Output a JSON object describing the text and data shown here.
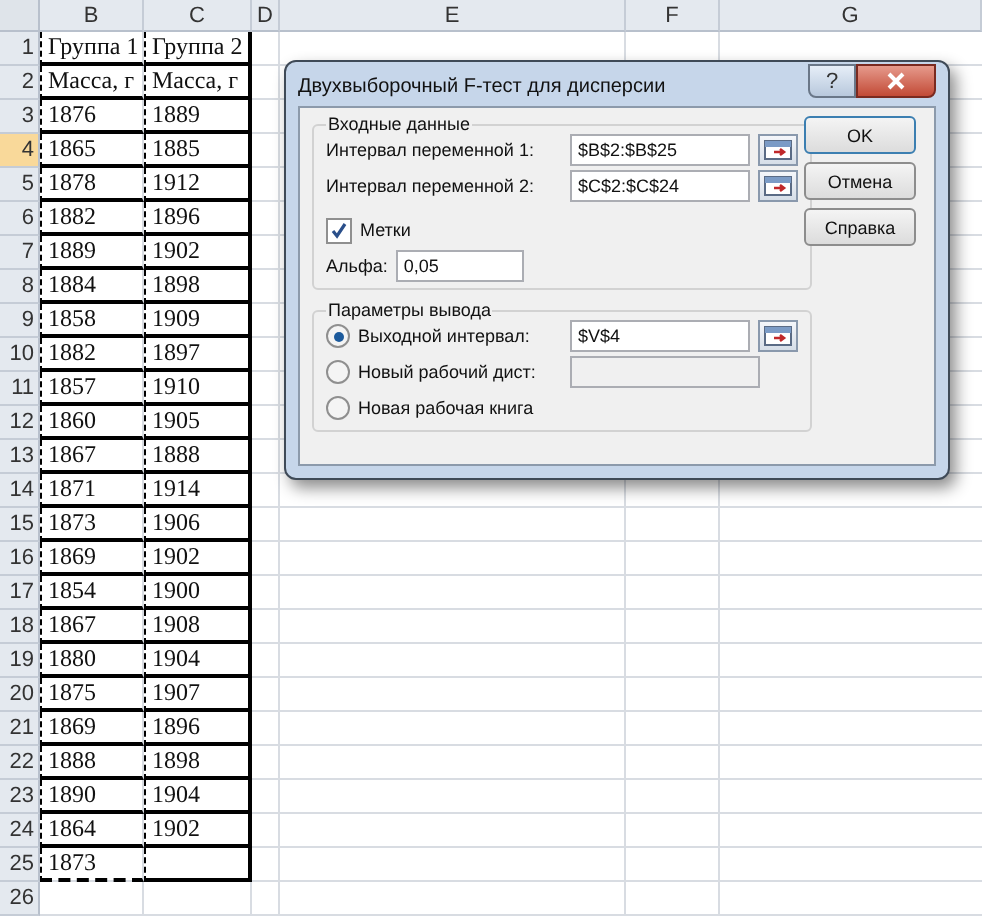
{
  "sheet": {
    "columns": [
      {
        "label": "B",
        "selected": false
      },
      {
        "label": "C",
        "selected": false
      },
      {
        "label": "D",
        "selected": false
      },
      {
        "label": "E",
        "selected": false
      },
      {
        "label": "F",
        "selected": false
      },
      {
        "label": "G",
        "selected": false
      }
    ],
    "rows": [
      {
        "number": "1",
        "selected": false,
        "cells": [
          "Группа 1",
          "Группа 2"
        ]
      },
      {
        "number": "2",
        "selected": false,
        "cells": [
          "Масса, г",
          "Масса, г"
        ]
      },
      {
        "number": "3",
        "selected": false,
        "cells": [
          "1876",
          "1889"
        ]
      },
      {
        "number": "4",
        "selected": true,
        "cells": [
          "1865",
          "1885"
        ]
      },
      {
        "number": "5",
        "selected": false,
        "cells": [
          "1878",
          "1912"
        ]
      },
      {
        "number": "6",
        "selected": false,
        "cells": [
          "1882",
          "1896"
        ]
      },
      {
        "number": "7",
        "selected": false,
        "cells": [
          "1889",
          "1902"
        ]
      },
      {
        "number": "8",
        "selected": false,
        "cells": [
          "1884",
          "1898"
        ]
      },
      {
        "number": "9",
        "selected": false,
        "cells": [
          "1858",
          "1909"
        ]
      },
      {
        "number": "10",
        "selected": false,
        "cells": [
          "1882",
          "1897"
        ]
      },
      {
        "number": "11",
        "selected": false,
        "cells": [
          "1857",
          "1910"
        ]
      },
      {
        "number": "12",
        "selected": false,
        "cells": [
          "1860",
          "1905"
        ]
      },
      {
        "number": "13",
        "selected": false,
        "cells": [
          "1867",
          "1888"
        ]
      },
      {
        "number": "14",
        "selected": false,
        "cells": [
          "1871",
          "1914"
        ]
      },
      {
        "number": "15",
        "selected": false,
        "cells": [
          "1873",
          "1906"
        ]
      },
      {
        "number": "16",
        "selected": false,
        "cells": [
          "1869",
          "1902"
        ]
      },
      {
        "number": "17",
        "selected": false,
        "cells": [
          "1854",
          "1900"
        ]
      },
      {
        "number": "18",
        "selected": false,
        "cells": [
          "1867",
          "1908"
        ]
      },
      {
        "number": "19",
        "selected": false,
        "cells": [
          "1880",
          "1904"
        ]
      },
      {
        "number": "20",
        "selected": false,
        "cells": [
          "1875",
          "1907"
        ]
      },
      {
        "number": "21",
        "selected": false,
        "cells": [
          "1869",
          "1896"
        ]
      },
      {
        "number": "22",
        "selected": false,
        "cells": [
          "1888",
          "1898"
        ]
      },
      {
        "number": "23",
        "selected": false,
        "cells": [
          "1890",
          "1904"
        ]
      },
      {
        "number": "24",
        "selected": false,
        "cells": [
          "1864",
          "1902"
        ]
      },
      {
        "number": "25",
        "selected": false,
        "cells": [
          "1873",
          ""
        ]
      },
      {
        "number": "26",
        "selected": false,
        "cells": []
      }
    ]
  },
  "dialog": {
    "title": "Двухвыборочный F-тест для дисперсии",
    "help": "?",
    "input_group": {
      "title": "Входные данные",
      "ranges": [
        {
          "label": "Интервал переменной 1:",
          "value": "$B$2:$B$25"
        },
        {
          "label": "Интервал переменной 2:",
          "value": "$C$2:$C$24"
        }
      ],
      "labels_checkbox": {
        "label": "Метки",
        "checked": true
      },
      "alpha": {
        "label": "Альфа:",
        "value": "0,05"
      }
    },
    "output_group": {
      "title": "Параметры вывода",
      "options": [
        {
          "label": "Выходной интервал:",
          "selected": true,
          "value": "$V$4",
          "kind": "range"
        },
        {
          "label": "Новый рабочий дист:",
          "selected": false,
          "kind": "text"
        },
        {
          "label": "Новая рабочая книга",
          "selected": false,
          "kind": "plain"
        }
      ]
    },
    "buttons": [
      "OK",
      "Отмена",
      "Справка"
    ]
  }
}
